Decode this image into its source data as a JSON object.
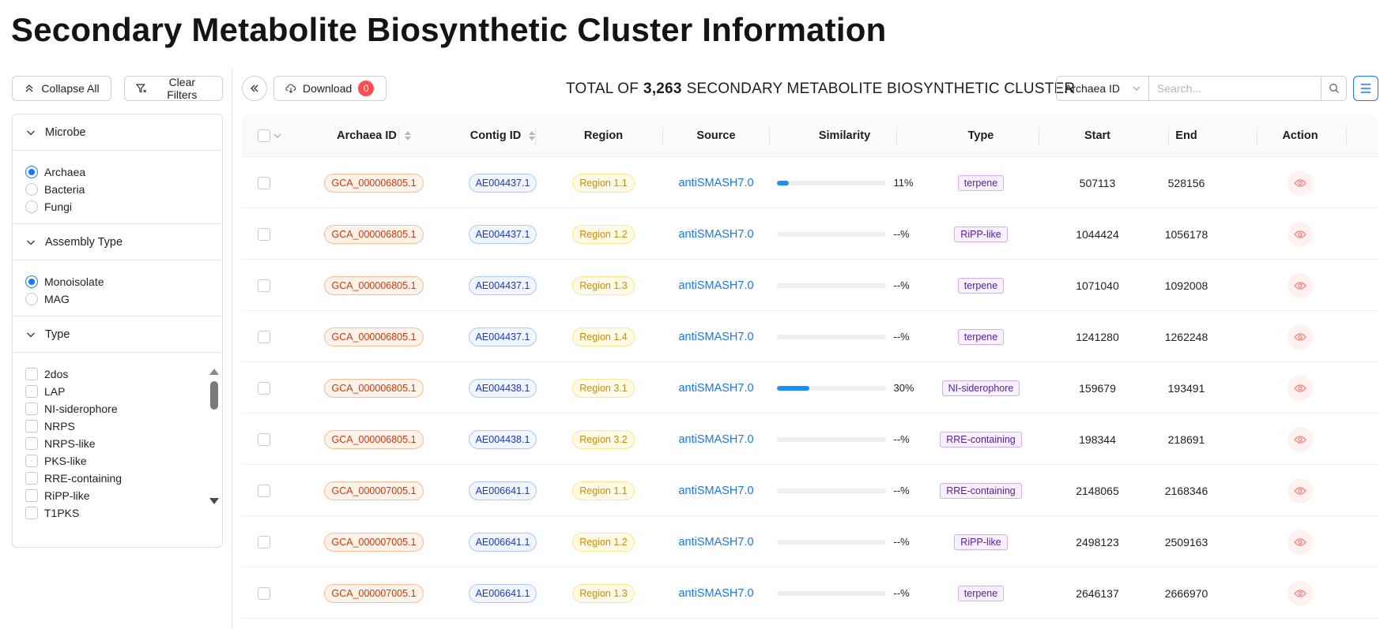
{
  "page_title": "Secondary Metabolite Biosynthetic Cluster Information",
  "filters": {
    "collapse_label": "Collapse All",
    "clear_label": "Clear Filters",
    "sections": [
      {
        "title": "Microbe",
        "kind": "radio",
        "options": [
          {
            "label": "Archaea",
            "selected": true
          },
          {
            "label": "Bacteria",
            "selected": false
          },
          {
            "label": "Fungi",
            "selected": false
          }
        ]
      },
      {
        "title": "Assembly Type",
        "kind": "radio",
        "options": [
          {
            "label": "Monoisolate",
            "selected": true
          },
          {
            "label": "MAG",
            "selected": false
          }
        ]
      },
      {
        "title": "Type",
        "kind": "checkbox",
        "options": [
          {
            "label": "2dos"
          },
          {
            "label": "LAP"
          },
          {
            "label": "NI-siderophore"
          },
          {
            "label": "NRPS"
          },
          {
            "label": "NRPS-like"
          },
          {
            "label": "PKS-like"
          },
          {
            "label": "RRE-containing"
          },
          {
            "label": "RiPP-like"
          },
          {
            "label": "T1PKS"
          }
        ]
      }
    ]
  },
  "toolbar": {
    "download_label": "Download",
    "download_count": "0",
    "total_prefix": "TOTAL OF",
    "total_count": "3,263",
    "total_suffix": "SECONDARY METABOLITE BIOSYNTHETIC CLUSTER",
    "search_field": "Archaea ID",
    "search_placeholder": "Search..."
  },
  "table": {
    "columns": [
      "Archaea ID",
      "Contig ID",
      "Region",
      "Source",
      "Similarity",
      "Type",
      "Start",
      "End",
      "Action"
    ],
    "rows": [
      {
        "archaea_id": "GCA_000006805.1",
        "contig_id": "AE004437.1",
        "region": "Region 1.1",
        "source": "antiSMASH7.0",
        "similarity_pct": 11,
        "similarity_text": "11%",
        "type": "terpene",
        "start": "507113",
        "end": "528156"
      },
      {
        "archaea_id": "GCA_000006805.1",
        "contig_id": "AE004437.1",
        "region": "Region 1.2",
        "source": "antiSMASH7.0",
        "similarity_pct": 0,
        "similarity_text": "--%",
        "type": "RiPP-like",
        "start": "1044424",
        "end": "1056178"
      },
      {
        "archaea_id": "GCA_000006805.1",
        "contig_id": "AE004437.1",
        "region": "Region 1.3",
        "source": "antiSMASH7.0",
        "similarity_pct": 0,
        "similarity_text": "--%",
        "type": "terpene",
        "start": "1071040",
        "end": "1092008"
      },
      {
        "archaea_id": "GCA_000006805.1",
        "contig_id": "AE004437.1",
        "region": "Region 1.4",
        "source": "antiSMASH7.0",
        "similarity_pct": 0,
        "similarity_text": "--%",
        "type": "terpene",
        "start": "1241280",
        "end": "1262248"
      },
      {
        "archaea_id": "GCA_000006805.1",
        "contig_id": "AE004438.1",
        "region": "Region 3.1",
        "source": "antiSMASH7.0",
        "similarity_pct": 30,
        "similarity_text": "30%",
        "type": "NI-siderophore",
        "start": "159679",
        "end": "193491"
      },
      {
        "archaea_id": "GCA_000006805.1",
        "contig_id": "AE004438.1",
        "region": "Region 3.2",
        "source": "antiSMASH7.0",
        "similarity_pct": 0,
        "similarity_text": "--%",
        "type": "RRE-containing",
        "start": "198344",
        "end": "218691"
      },
      {
        "archaea_id": "GCA_000007005.1",
        "contig_id": "AE006641.1",
        "region": "Region 1.1",
        "source": "antiSMASH7.0",
        "similarity_pct": 0,
        "similarity_text": "--%",
        "type": "RRE-containing",
        "start": "2148065",
        "end": "2168346"
      },
      {
        "archaea_id": "GCA_000007005.1",
        "contig_id": "AE006641.1",
        "region": "Region 1.2",
        "source": "antiSMASH7.0",
        "similarity_pct": 0,
        "similarity_text": "--%",
        "type": "RiPP-like",
        "start": "2498123",
        "end": "2509163"
      },
      {
        "archaea_id": "GCA_000007005.1",
        "contig_id": "AE006641.1",
        "region": "Region 1.3",
        "source": "antiSMASH7.0",
        "similarity_pct": 0,
        "similarity_text": "--%",
        "type": "terpene",
        "start": "2646137",
        "end": "2666970"
      }
    ]
  },
  "colors": {
    "accent": "#1677ff",
    "badge": "#ff4d4f",
    "action_icon": "#ff7875"
  }
}
